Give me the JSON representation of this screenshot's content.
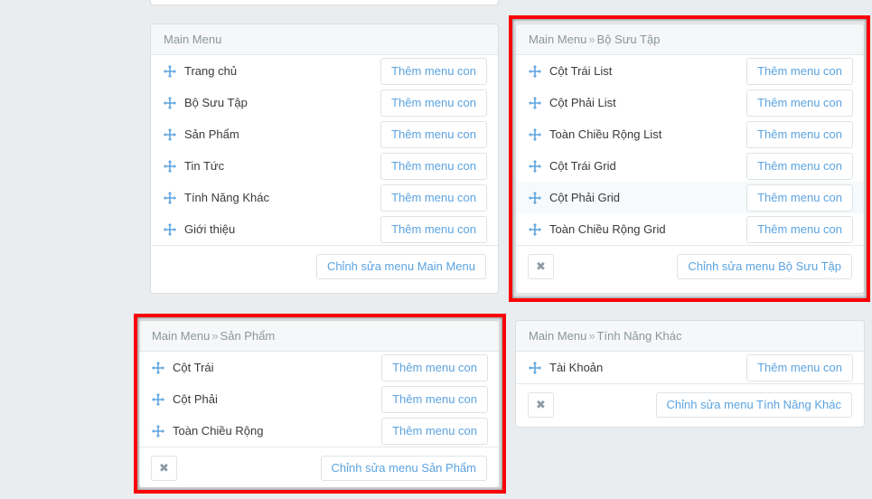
{
  "page": {
    "background_color": "#e9edef",
    "accent_color": "#5ba3e0",
    "highlight_frame_color": "#fb0007",
    "drag_icon": "move-arrows-icon",
    "close_icon": "✖",
    "breadcrumb_separator": "»"
  },
  "panels": [
    {
      "id": "main-menu",
      "title": "Main Menu",
      "breadcrumb_parent": "",
      "breadcrumb_child": "",
      "highlighted": false,
      "has_close_button": false,
      "items": [
        {
          "label": "Trang chủ",
          "action_label": "Thêm menu con",
          "highlighted": false
        },
        {
          "label": "Bộ Sưu Tập",
          "action_label": "Thêm menu con",
          "highlighted": false
        },
        {
          "label": "Sản Phẩm",
          "action_label": "Thêm menu con",
          "highlighted": false
        },
        {
          "label": "Tin Tức",
          "action_label": "Thêm menu con",
          "highlighted": false
        },
        {
          "label": "Tính Năng Khác",
          "action_label": "Thêm menu con",
          "highlighted": false
        },
        {
          "label": "Giới thiệu",
          "action_label": "Thêm menu con",
          "highlighted": false
        }
      ],
      "footer_button": "Chỉnh sửa menu Main Menu"
    },
    {
      "id": "bo-suu-tap",
      "title": "Main Menu » Bộ Sưu Tập",
      "breadcrumb_parent": "Main Menu",
      "breadcrumb_child": "Bộ Sưu Tập",
      "highlighted": true,
      "has_close_button": true,
      "close_label": "✖",
      "items": [
        {
          "label": "Cột Trái List",
          "action_label": "Thêm menu con",
          "highlighted": false
        },
        {
          "label": "Cột Phải List",
          "action_label": "Thêm menu con",
          "highlighted": false
        },
        {
          "label": "Toàn Chiều Rộng List",
          "action_label": "Thêm menu con",
          "highlighted": false
        },
        {
          "label": "Cột Trái Grid",
          "action_label": "Thêm menu con",
          "highlighted": false
        },
        {
          "label": "Cột Phải Grid",
          "action_label": "Thêm menu con",
          "highlighted": true
        },
        {
          "label": "Toàn Chiều Rộng Grid",
          "action_label": "Thêm menu con",
          "highlighted": false
        }
      ],
      "footer_button": "Chỉnh sửa menu Bộ Sưu Tập"
    },
    {
      "id": "san-pham",
      "title": "Main Menu » Sản Phẩm",
      "breadcrumb_parent": "Main Menu",
      "breadcrumb_child": "Sản Phẩm",
      "highlighted": true,
      "has_close_button": true,
      "close_label": "✖",
      "items": [
        {
          "label": "Cột Trái",
          "action_label": "Thêm menu con",
          "highlighted": false
        },
        {
          "label": "Cột Phải",
          "action_label": "Thêm menu con",
          "highlighted": false
        },
        {
          "label": "Toàn Chiều Rộng",
          "action_label": "Thêm menu con",
          "highlighted": false
        }
      ],
      "footer_button": "Chỉnh sửa menu Sản Phẩm"
    },
    {
      "id": "tinh-nang-khac",
      "title": "Main Menu » Tính Năng Khác",
      "breadcrumb_parent": "Main Menu",
      "breadcrumb_child": "Tính Năng Khác",
      "highlighted": false,
      "has_close_button": true,
      "close_label": "✖",
      "items": [
        {
          "label": "Tài Khoản",
          "action_label": "Thêm menu con",
          "highlighted": false
        }
      ],
      "footer_button": "Chỉnh sửa menu Tính Năng Khác"
    }
  ]
}
